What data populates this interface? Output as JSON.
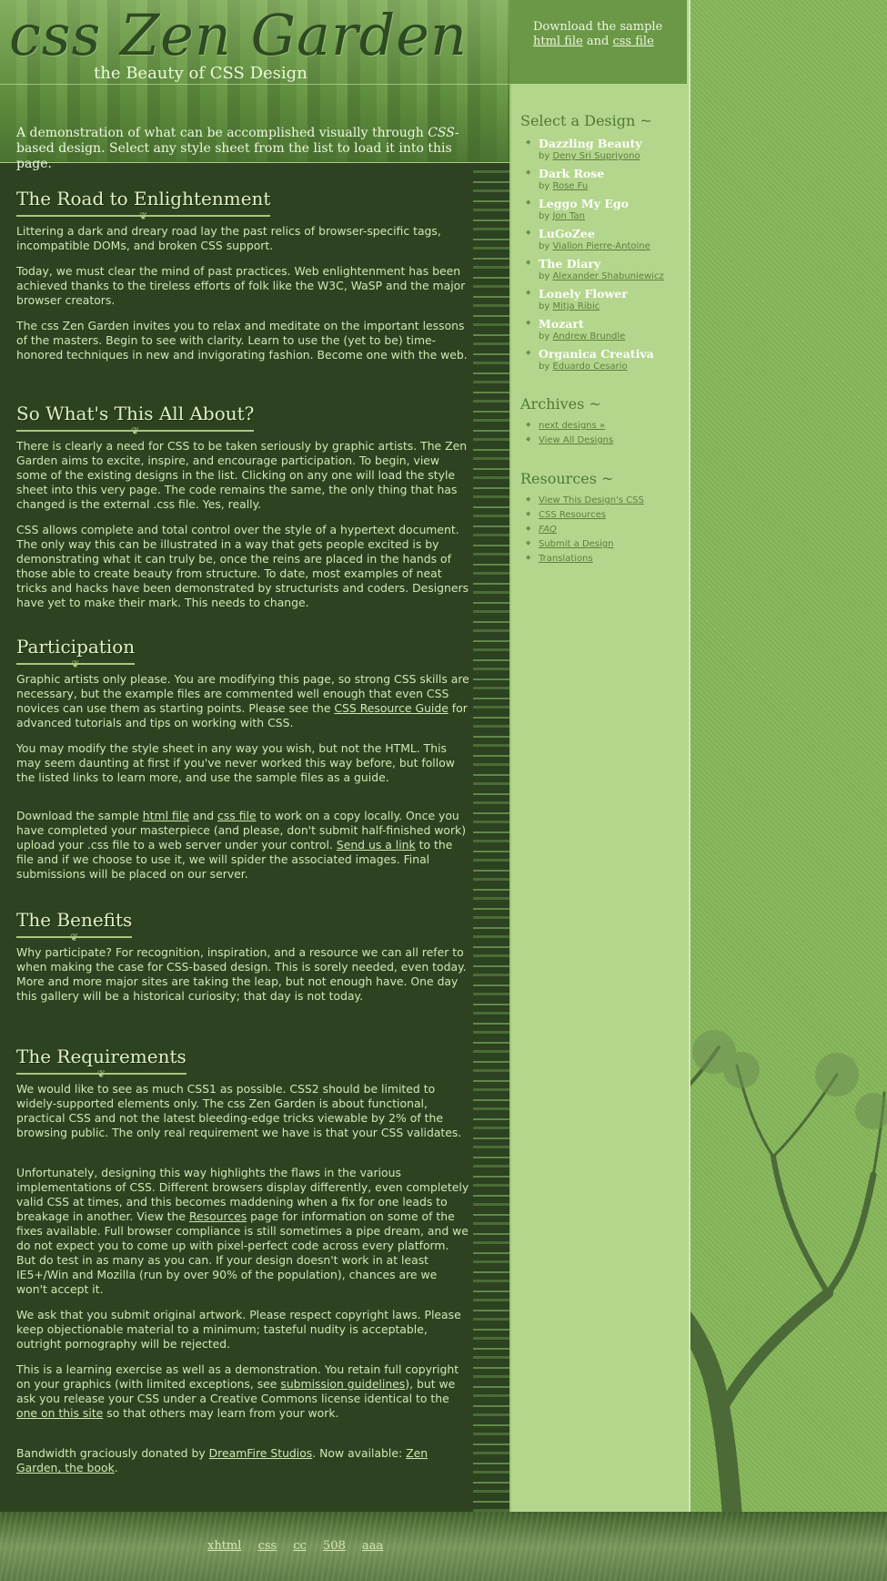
{
  "header": {
    "logo": "css Zen Garden",
    "tagline": "the Beauty of CSS Design",
    "intro_before": "A demonstration of what can be accomplished visually through ",
    "intro_css": "CSS",
    "intro_after": "-based design. Select any style sheet from the list to load it into this page."
  },
  "sections": {
    "road": {
      "title": "The Road to Enlightenment",
      "p1": "Littering a dark and dreary road lay the past relics of browser-specific tags, incompatible DOMs, and broken CSS support.",
      "p2": "Today, we must clear the mind of past practices. Web enlightenment has been achieved thanks to the tireless efforts of folk like the W3C, WaSP and the major browser creators.",
      "p3": "The css Zen Garden invites you to relax and meditate on the important lessons of the masters. Begin to see with clarity. Learn to use the (yet to be) time-honored techniques in new and invigorating fashion. Become one with the web."
    },
    "about": {
      "title": "So What's This All About?",
      "p1": "There is clearly a need for CSS to be taken seriously by graphic artists. The Zen Garden aims to excite, inspire, and encourage participation. To begin, view some of the existing designs in the list. Clicking on any one will load the style sheet into this very page. The code remains the same, the only thing that has changed is the external .css file. Yes, really.",
      "p2": "CSS allows complete and total control over the style of a hypertext document. The only way this can be illustrated in a way that gets people excited is by demonstrating what it can truly be, once the reins are placed in the hands of those able to create beauty from structure. To date, most examples of neat tricks and hacks have been demonstrated by structurists and coders. Designers have yet to make their mark. This needs to change."
    },
    "participation": {
      "title": "Participation",
      "p1_a": "Graphic artists only please. You are modifying this page, so strong CSS skills are necessary, but the example files are commented well enough that even CSS novices can use them as starting points. Please see the ",
      "p1_link": "CSS Resource Guide",
      "p1_b": " for advanced tutorials and tips on working with CSS.",
      "p2": "You may modify the style sheet in any way you wish, but not the HTML. This may seem daunting at first if you've never worked this way before, but follow the listed links to learn more, and use the sample files as a guide.",
      "p3_a": "Download the sample ",
      "p3_html": "html file",
      "p3_and": " and ",
      "p3_css": "css file",
      "p3_b": " to work on a copy locally. Once you have completed your masterpiece (and please, don't submit half-finished work) upload your .css file to a web server under your control. ",
      "p3_send": "Send us a link",
      "p3_c": " to the file and if we choose to use it, we will spider the associated images. Final submissions will be placed on our server."
    },
    "benefits": {
      "title": "The Benefits",
      "p1": "Why participate? For recognition, inspiration, and a resource we can all refer to when making the case for CSS-based design. This is sorely needed, even today. More and more major sites are taking the leap, but not enough have. One day this gallery will be a historical curiosity; that day is not today."
    },
    "requirements": {
      "title": "The Requirements",
      "p1": "We would like to see as much CSS1 as possible. CSS2 should be limited to widely-supported elements only. The css Zen Garden is about functional, practical CSS and not the latest bleeding-edge tricks viewable by 2% of the browsing public. The only real requirement we have is that your CSS validates.",
      "p2_a": "Unfortunately, designing this way highlights the flaws in the various implementations of CSS. Different browsers display differently, even completely valid CSS at times, and this becomes maddening when a fix for one leads to breakage in another. View the ",
      "p2_link": "Resources",
      "p2_b": " page for information on some of the fixes available. Full browser compliance is still sometimes a pipe dream, and we do not expect you to come up with pixel-perfect code across every platform. But do test in as many as you can. If your design doesn't work in at least IE5+/Win and Mozilla (run by over 90% of the population), chances are we won't accept it.",
      "p3": "We ask that you submit original artwork. Please respect copyright laws. Please keep objectionable material to a minimum; tasteful nudity is acceptable, outright pornography will be rejected.",
      "p4_a": "This is a learning exercise as well as a demonstration. You retain full copyright on your graphics (with limited exceptions, see ",
      "p4_link1": "submission guidelines",
      "p4_b": "), but we ask you release your CSS under a Creative Commons license identical to the ",
      "p4_link2": "one on this site",
      "p4_c": " so that others may learn from your work.",
      "p5_a": "Bandwidth graciously donated by ",
      "p5_link1": "DreamFire Studios",
      "p5_b": ". Now available: ",
      "p5_link2": "Zen Garden, the book",
      "p5_c": "."
    }
  },
  "sidebar": {
    "download_text": "Download the sample",
    "download_html": "html file",
    "download_and": "and",
    "download_css": "css file",
    "select_heading": "Select a Design ~",
    "designs": [
      {
        "name": "Dazzling Beauty",
        "by": "by",
        "author": "Deny Sri Supriyono"
      },
      {
        "name": "Dark Rose",
        "by": "by",
        "author": "Rose Fu"
      },
      {
        "name": "Leggo My Ego",
        "by": "by",
        "author": "Jon Tan"
      },
      {
        "name": "LuGoZee",
        "by": "by",
        "author": "Viallon Pierre-Antoine"
      },
      {
        "name": "The Diary",
        "by": "by",
        "author": "Alexander Shabuniewicz"
      },
      {
        "name": "Lonely Flower",
        "by": "by",
        "author": "Mitja Ribic"
      },
      {
        "name": "Mozart",
        "by": "by",
        "author": "Andrew Brundle"
      },
      {
        "name": "Organica Creativa",
        "by": "by",
        "author": "Eduardo Cesario"
      }
    ],
    "archives_heading": "Archives ~",
    "archives": [
      "next designs »",
      "View All Designs"
    ],
    "resources_heading": "Resources ~",
    "resources": [
      "View This Design's CSS",
      "CSS Resources",
      "FAQ",
      "Submit a Design",
      "Translations"
    ]
  },
  "footer": {
    "links": [
      "xhtml",
      "css",
      "cc",
      "508",
      "aaa"
    ]
  },
  "colors": {
    "main_bg": "#2c4220",
    "sidebar_bg": "#b4d68c",
    "page_bg": "#8ab85e",
    "body_text": "#d4e6b4"
  }
}
